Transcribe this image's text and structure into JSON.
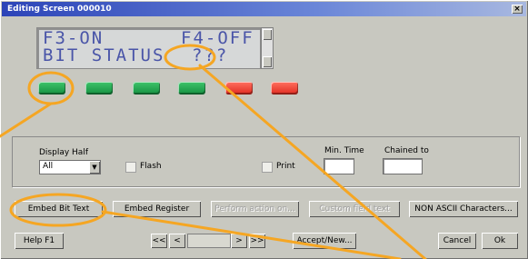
{
  "window": {
    "title": "Editing Screen 000010",
    "close_icon": "close-icon"
  },
  "lcd": {
    "line1_left": "F3-ON",
    "line1_right": "F4-OFF",
    "line2_left": "BIT STATUS",
    "line2_right": "???"
  },
  "lamps": [
    {
      "state": "on",
      "color": "#1aa24a"
    },
    {
      "state": "on",
      "color": "#1aa24a"
    },
    {
      "state": "on",
      "color": "#1aa24a"
    },
    {
      "state": "on",
      "color": "#1aa24a"
    },
    {
      "state": "on",
      "color": "#ee3a2a"
    },
    {
      "state": "on",
      "color": "#ee3a2a"
    }
  ],
  "options": {
    "display_half_label": "Display Half",
    "display_half_value": "All",
    "flash_label": "Flash",
    "flash_checked": false,
    "print_label": "Print",
    "print_checked": false,
    "min_time_label": "Min. Time",
    "min_time_value": "",
    "chained_to_label": "Chained to",
    "chained_to_value": ""
  },
  "buttons": {
    "embed_bit_text": "Embed Bit Text",
    "embed_register": "Embed Register",
    "perform_action": "Perform action on...",
    "custom_field": "Custom field text",
    "non_ascii": "NON ASCII Characters...",
    "help": "Help F1",
    "accept_new": "Accept/New...",
    "cancel": "Cancel",
    "ok": "Ok"
  },
  "navigation": {
    "first": "<<",
    "prev": "<",
    "next": ">",
    "last": ">>",
    "record": ""
  },
  "colors": {
    "callout": "#f5a623",
    "titlebar": "#2c44b8",
    "lcd_text": "#4a55a8"
  }
}
